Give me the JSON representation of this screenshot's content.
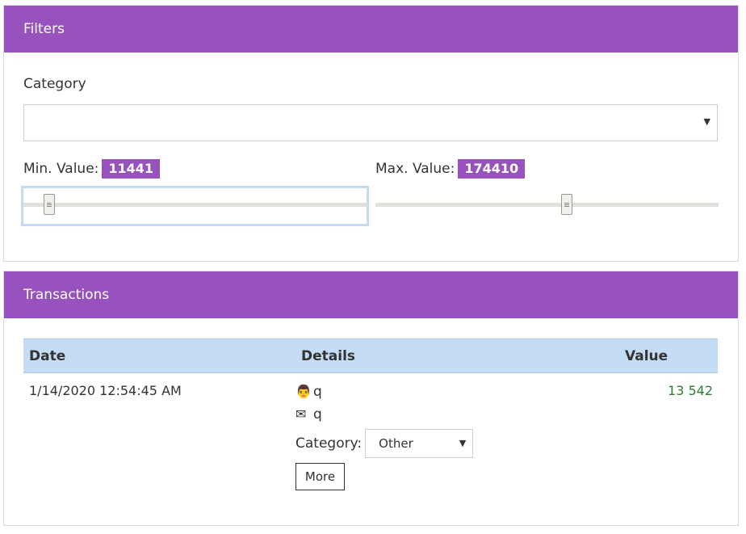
{
  "filters": {
    "title": "Filters",
    "category_label": "Category",
    "category_value": "",
    "min_label": "Min. Value:",
    "min_value": "11441",
    "max_label": "Max. Value:",
    "max_value": "174410",
    "min_slider_level": 0.06,
    "max_slider_level": 0.56
  },
  "transactions": {
    "title": "Transactions",
    "columns": [
      "Date",
      "Details",
      "Value"
    ],
    "rows": [
      {
        "date": "1/14/2020 12:54:45 AM",
        "person_icon": "person-emoji-icon",
        "person": "q",
        "email_icon": "envelope-icon",
        "email": "q",
        "category_label": "Category:",
        "category_value": "Other",
        "more_label": "More",
        "value": "13 542"
      }
    ]
  },
  "colors": {
    "header": "#9852be",
    "table_header": "#c5dcf5",
    "value_text": "#2e7d32"
  }
}
